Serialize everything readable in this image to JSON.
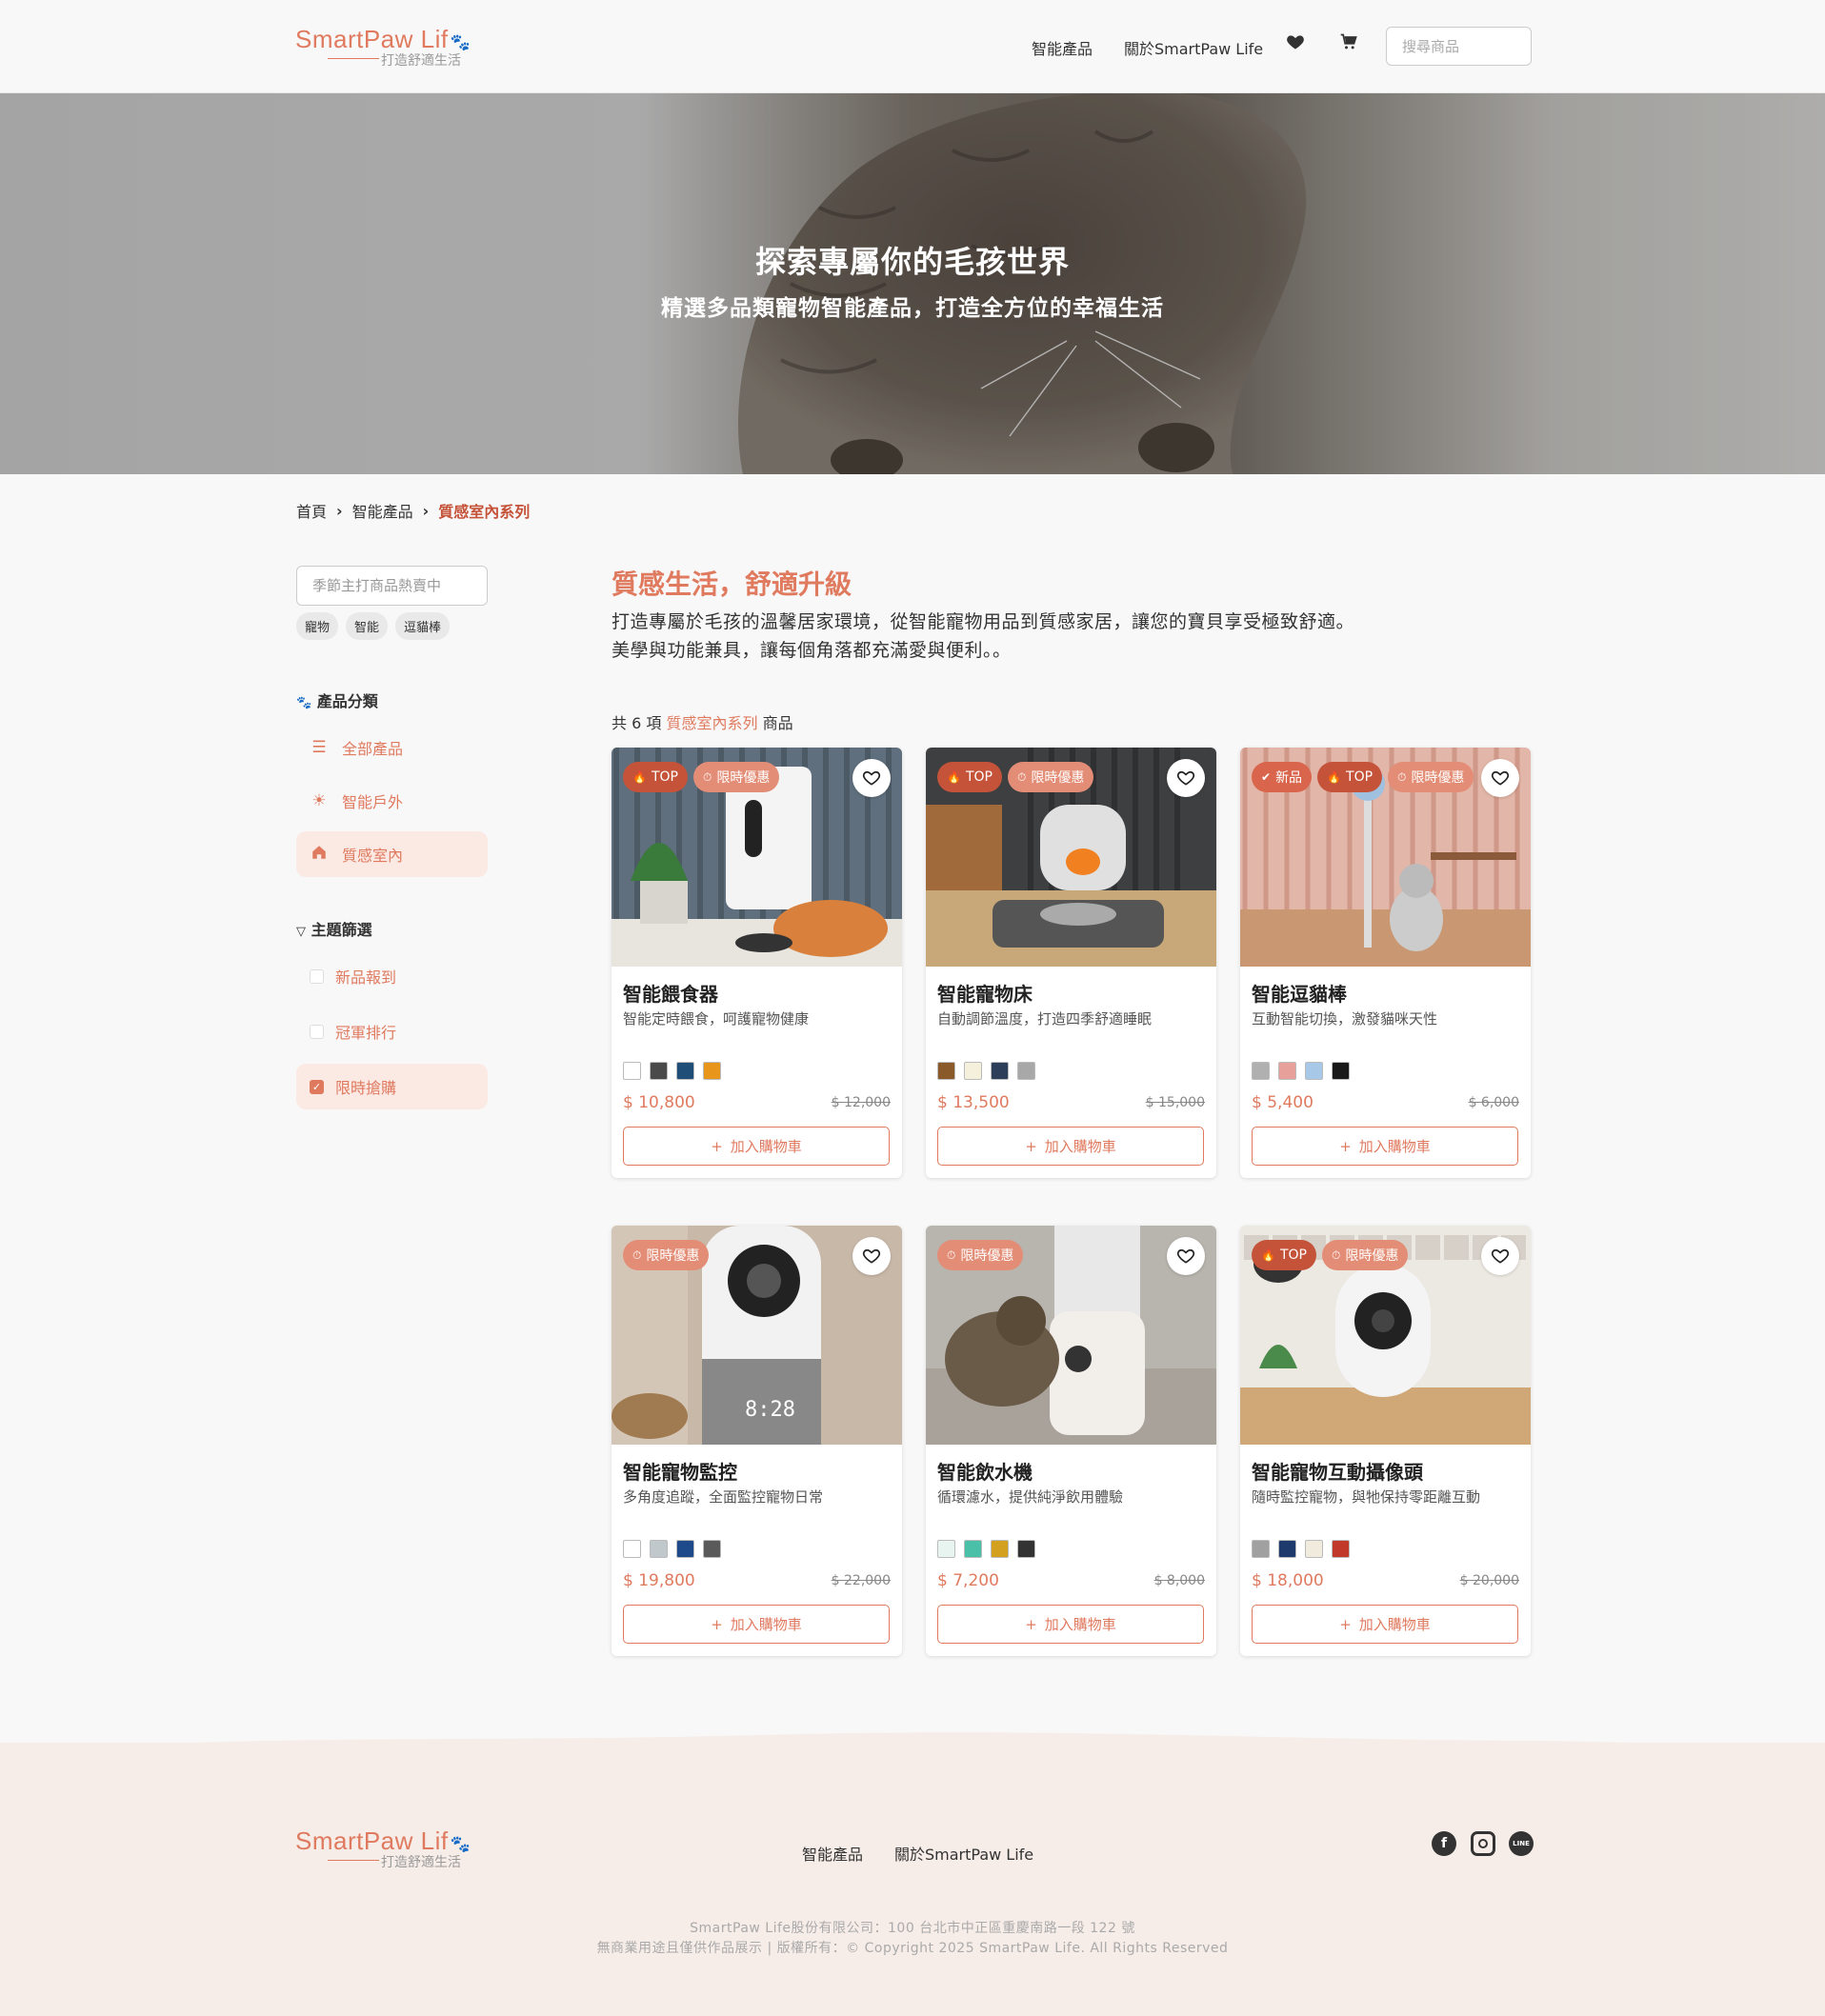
{
  "brand": {
    "name": "SmartPaw Lif",
    "slogan": "打造舒適生活"
  },
  "nav": {
    "links": [
      "智能產品",
      "關於SmartPaw Life"
    ],
    "search_placeholder": "搜尋商品"
  },
  "hero": {
    "title": "探索專屬你的毛孩世界",
    "subtitle": "精選多品類寵物智能產品，打造全方位的幸福生活"
  },
  "breadcrumb": {
    "items": [
      "首頁",
      "智能產品"
    ],
    "current": "質感室內系列"
  },
  "sidebar": {
    "search_placeholder": "季節主打商品熱賣中",
    "tags": [
      "寵物",
      "智能",
      "逗貓棒"
    ],
    "category_heading": "產品分類",
    "categories": [
      {
        "label": "全部產品",
        "icon": "list-icon"
      },
      {
        "label": "智能戶外",
        "icon": "sun-icon"
      },
      {
        "label": "質感室內",
        "icon": "home-icon",
        "active": true
      }
    ],
    "filter_heading": "主題篩選",
    "filters": [
      {
        "label": "新品報到",
        "checked": false
      },
      {
        "label": "冠軍排行",
        "checked": false
      },
      {
        "label": "限時搶購",
        "checked": true
      }
    ]
  },
  "main": {
    "title": "質感生活，舒適升級",
    "desc_line1": "打造專屬於毛孩的溫馨居家環境，從智能寵物用品到質感家居，讓您的寶貝享受極致舒適。",
    "desc_line2": "美學與功能兼具，讓每個角落都充滿愛與便利。。",
    "count_prefix": "共 6 項",
    "count_category": "質感室內系列",
    "count_suffix": "商品"
  },
  "products": [
    {
      "name": "智能餵食器",
      "desc": "智能定時餵食，呵護寵物健康",
      "price": "$ 10,800",
      "old_price": "$ 12,000",
      "badges": [
        {
          "type": "top",
          "label": "TOP"
        },
        {
          "type": "sale",
          "label": "限時優惠"
        }
      ],
      "colors": [
        "#ffffff",
        "#4a4a4a",
        "#1f4e79",
        "#e8951c"
      ]
    },
    {
      "name": "智能寵物床",
      "desc": "自動調節溫度，打造四季舒適睡眠",
      "price": "$ 13,500",
      "old_price": "$ 15,000",
      "badges": [
        {
          "type": "top",
          "label": "TOP"
        },
        {
          "type": "sale",
          "label": "限時優惠"
        }
      ],
      "colors": [
        "#8b5a2b",
        "#f5f0dc",
        "#2c3e5a",
        "#a8a8a8"
      ]
    },
    {
      "name": "智能逗貓棒",
      "desc": "互動智能切換，激發貓咪天性",
      "price": "$ 5,400",
      "old_price": "$ 6,000",
      "badges": [
        {
          "type": "new",
          "label": "新品"
        },
        {
          "type": "top",
          "label": "TOP"
        },
        {
          "type": "sale",
          "label": "限時優惠"
        }
      ],
      "colors": [
        "#b0b0b0",
        "#e8a09a",
        "#a8c8e8",
        "#1a1a1a"
      ]
    },
    {
      "name": "智能寵物監控",
      "desc": "多角度追蹤，全面監控寵物日常",
      "price": "$ 19,800",
      "old_price": "$ 22,000",
      "badges": [
        {
          "type": "sale",
          "label": "限時優惠"
        }
      ],
      "colors": [
        "#ffffff",
        "#c0c8cc",
        "#1e4a8c",
        "#5a5a5a"
      ]
    },
    {
      "name": "智能飲水機",
      "desc": "循環濾水，提供純淨飲用體驗",
      "price": "$ 7,200",
      "old_price": "$ 8,000",
      "badges": [
        {
          "type": "sale",
          "label": "限時優惠"
        }
      ],
      "colors": [
        "#e8f4f0",
        "#4ac0a8",
        "#d4a020",
        "#333333"
      ]
    },
    {
      "name": "智能寵物互動攝像頭",
      "desc": "隨時監控寵物，與牠保持零距離互動",
      "price": "$ 18,000",
      "old_price": "$ 20,000",
      "badges": [
        {
          "type": "top",
          "label": "TOP"
        },
        {
          "type": "sale",
          "label": "限時優惠"
        }
      ],
      "colors": [
        "#a0a0a0",
        "#1e3a6c",
        "#f0ebdc",
        "#c0392b"
      ]
    }
  ],
  "add_to_cart": "加入購物車",
  "footer": {
    "links": [
      "智能產品",
      "關於SmartPaw Life"
    ],
    "social": [
      "facebook-icon",
      "instagram-icon",
      "line-icon"
    ],
    "line_label": "LINE",
    "company": "SmartPaw Life股份有限公司：100 台北市中正區重慶南路一段 122 號",
    "copyright": "無商業用途且僅供作品展示 | 版權所有：© Copyright 2025 SmartPaw Life. All Rights Reserved"
  },
  "accent_color": "#e07a5f"
}
